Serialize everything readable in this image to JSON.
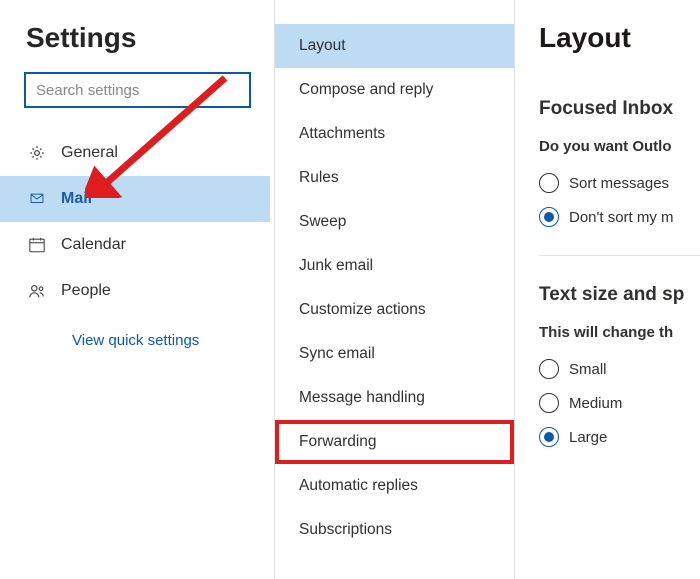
{
  "leftPanel": {
    "title": "Settings",
    "searchPlaceholder": "Search settings",
    "navItems": [
      {
        "label": "General"
      },
      {
        "label": "Mail"
      },
      {
        "label": "Calendar"
      },
      {
        "label": "People"
      }
    ],
    "quickLink": "View quick settings"
  },
  "middlePanel": {
    "items": [
      "Layout",
      "Compose and reply",
      "Attachments",
      "Rules",
      "Sweep",
      "Junk email",
      "Customize actions",
      "Sync email",
      "Message handling",
      "Forwarding",
      "Automatic replies",
      "Subscriptions"
    ]
  },
  "rightPanel": {
    "title": "Layout",
    "section1": {
      "heading": "Focused Inbox",
      "sub": "Do you want Outlo",
      "opt1": "Sort messages",
      "opt2": "Don't sort my m"
    },
    "section2": {
      "heading": "Text size and sp",
      "sub": "This will change th",
      "opt1": "Small",
      "opt2": "Medium",
      "opt3": "Large"
    }
  }
}
